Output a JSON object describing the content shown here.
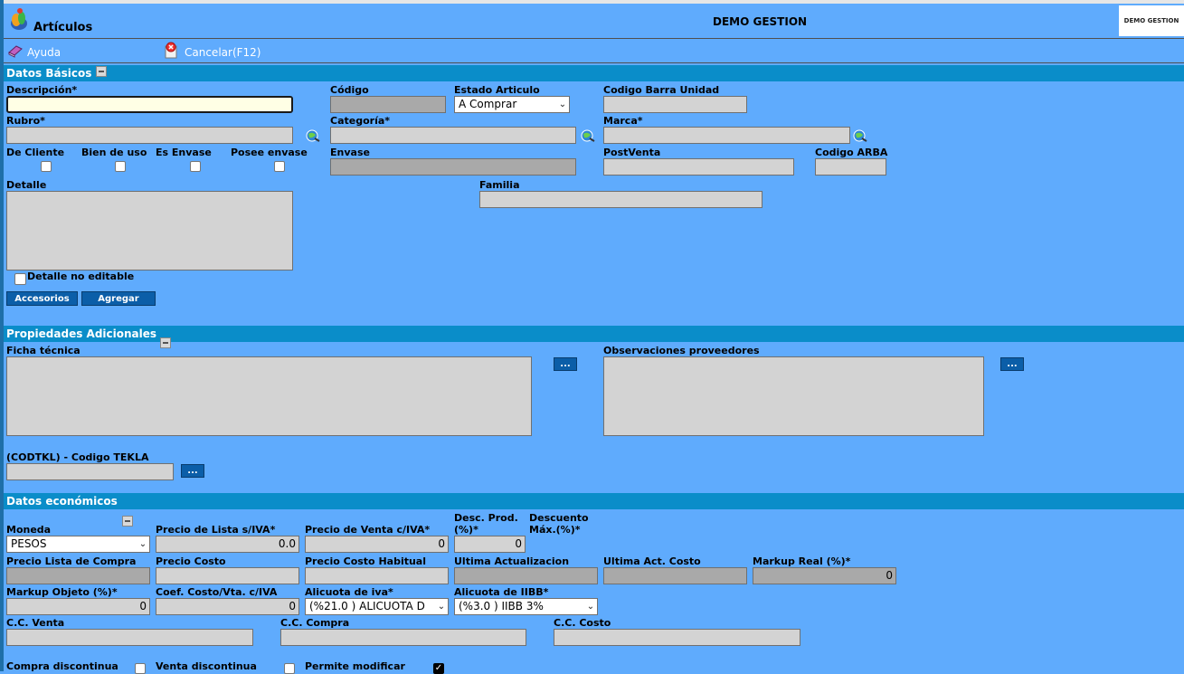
{
  "window": {
    "title": "Artículos",
    "app_name": "DEMO GESTION",
    "logo_text": "DEMO GESTION"
  },
  "toolbar": {
    "help_label": "Ayuda",
    "cancel_label": "Cancelar(F12)"
  },
  "sections": {
    "basic": "Datos Básicos",
    "additional": "Propiedades Adicionales",
    "economic": "Datos económicos"
  },
  "basic": {
    "descripcion_label": "Descripción*",
    "descripcion_value": "",
    "codigo_label": "Código",
    "estado_label": "Estado Articulo",
    "estado_value": "A Comprar",
    "codbarra_label": "Codigo Barra Unidad",
    "rubro_label": "Rubro*",
    "categoria_label": "Categoría*",
    "marca_label": "Marca*",
    "de_cliente_label": "De Cliente",
    "bien_uso_label": "Bien de uso",
    "es_envase_label": "Es Envase",
    "posee_envase_label": "Posee envase",
    "envase_label": "Envase",
    "postventa_label": "PostVenta",
    "codigo_arba_label": "Codigo ARBA",
    "detalle_label": "Detalle",
    "familia_label": "Familia",
    "detalle_no_editable_label": "Detalle no editable",
    "accesorios_label": "Accesorios",
    "agregar_label": "Agregar"
  },
  "additional": {
    "ficha_label": "Ficha técnica",
    "obs_label": "Observaciones proveedores",
    "tekla_label": "(CODTKL) - Codigo TEKLA",
    "dots": "..."
  },
  "economic": {
    "moneda_label": "Moneda",
    "moneda_value": "PESOS",
    "precio_lista_label": "Precio de Lista s/IVA*",
    "precio_lista_value": "0.0",
    "precio_venta_label": "Precio de Venta c/IVA*",
    "precio_venta_value": "0",
    "desc_prod_label_1": "Desc. Prod.",
    "desc_prod_label_2": "(%)*",
    "desc_prod_value": "0",
    "desc_max_label_1": "Descuento",
    "desc_max_label_2": "Máx.(%)*",
    "precio_lista_compra_label": "Precio Lista de Compra",
    "precio_costo_label": "Precio Costo",
    "precio_costo_hab_label": "Precio Costo Habitual",
    "ultima_act_label": "Ultima Actualizacion",
    "ultima_act_costo_label": "Ultima Act. Costo",
    "markup_real_label": "Markup Real (%)*",
    "markup_real_value": "0",
    "markup_obj_label": "Markup Objeto (%)*",
    "markup_obj_value": "0",
    "coef_label": "Coef. Costo/Vta. c/IVA",
    "coef_value": "0",
    "alic_iva_label": "Alicuota de iva*",
    "alic_iva_value": "(%21.0 ) ALICUOTA D",
    "alic_iibb_label": "Alicuota de IIBB*",
    "alic_iibb_value": "(%3.0 ) IIBB 3%",
    "cc_venta_label": "C.C. Venta",
    "cc_compra_label": "C.C. Compra",
    "cc_costo_label": "C.C. Costo",
    "compra_disc_label": "Compra discontinua",
    "venta_disc_label": "Venta discontinua",
    "permite_mod_label": "Permite modificar"
  }
}
